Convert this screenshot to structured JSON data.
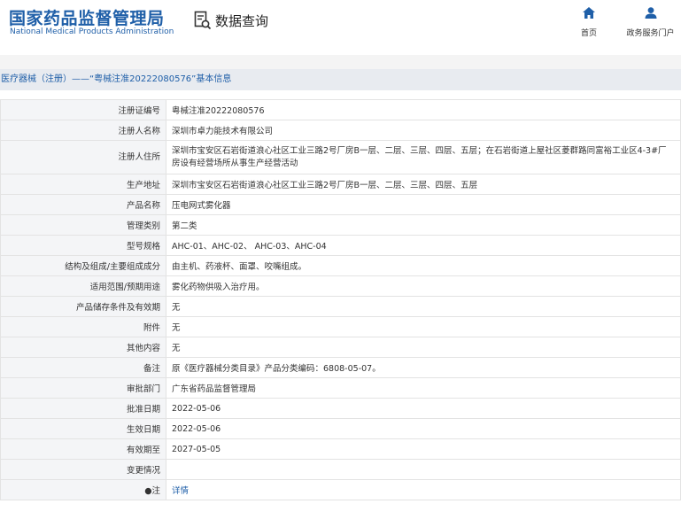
{
  "header": {
    "logo_cn": "国家药品监督管理局",
    "logo_en": "National Medical Products Administration",
    "query_title": "数据查询",
    "nav_home": "首页",
    "nav_service": "政务服务门户"
  },
  "breadcrumb": "医疗器械（注册）——“粤械注准20222080576”基本信息",
  "rows": [
    {
      "label": "注册证编号",
      "value": "粤械注准20222080576"
    },
    {
      "label": "注册人名称",
      "value": "深圳市卓力能技术有限公司"
    },
    {
      "label": "注册人住所",
      "value": "深圳市宝安区石岩街道浪心社区工业三路2号厂房B一层、二层、三层、四层、五层；在石岩街道上屋社区菱群路同富裕工业区4-3#厂房设有经营场所从事生产经营活动"
    },
    {
      "label": "生产地址",
      "value": "深圳市宝安区石岩街道浪心社区工业三路2号厂房B一层、二层、三层、四层、五层"
    },
    {
      "label": "产品名称",
      "value": "压电网式雾化器"
    },
    {
      "label": "管理类别",
      "value": "第二类"
    },
    {
      "label": "型号规格",
      "value": "AHC-01、AHC-02、 AHC-03、AHC-04"
    },
    {
      "label": "结构及组成/主要组成成分",
      "value": "由主机、药液杯、面罩、咬嘴组成。"
    },
    {
      "label": "适用范围/预期用途",
      "value": "雾化药物供吸入治疗用。"
    },
    {
      "label": "产品储存条件及有效期",
      "value": "无"
    },
    {
      "label": "附件",
      "value": "无"
    },
    {
      "label": "其他内容",
      "value": "无"
    },
    {
      "label": "备注",
      "value": "原《医疗器械分类目录》产品分类编码：6808-05-07。"
    },
    {
      "label": "审批部门",
      "value": "广东省药品监督管理局"
    },
    {
      "label": "批准日期",
      "value": "2022-05-06"
    },
    {
      "label": "生效日期",
      "value": "2022-05-06"
    },
    {
      "label": "有效期至",
      "value": "2027-05-05"
    },
    {
      "label": "变更情况",
      "value": ""
    },
    {
      "label": "●注",
      "value": "详情"
    }
  ],
  "colors": {
    "brand": "#1f5fa8",
    "label_bg": "#f4f5f7",
    "breadcrumb_bg": "#e8ebf0"
  }
}
